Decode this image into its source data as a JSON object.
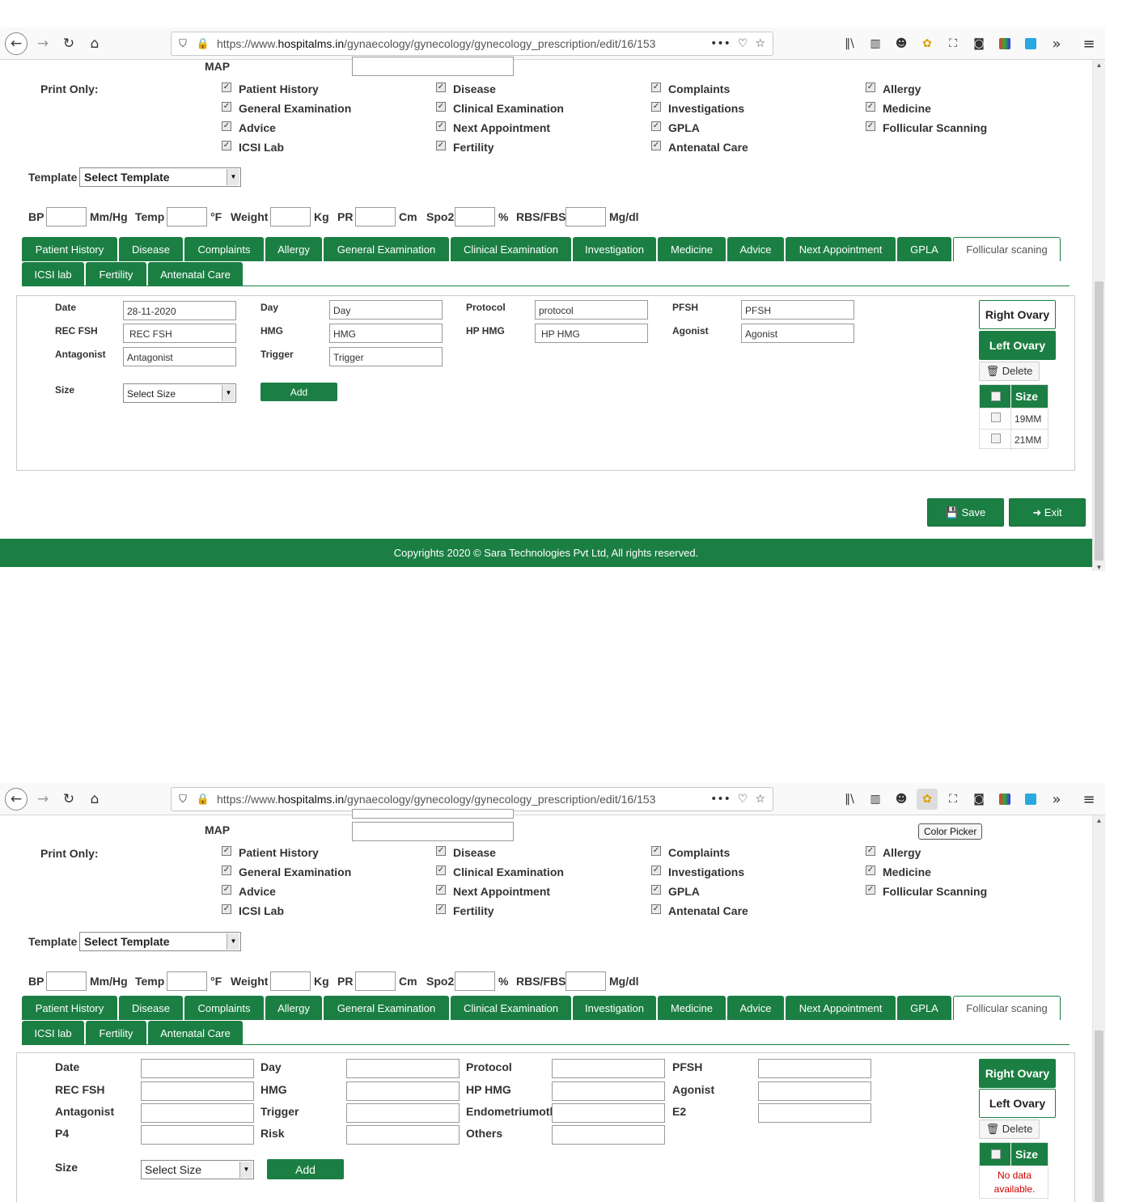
{
  "browser": {
    "url_prefix": "https://www.",
    "url_domain": "hospitalms.in",
    "url_path": "/gynaecology/gynecology/gynecology_prescription/edit/16/153",
    "overflow_icon": "»",
    "menu_icon": "≡"
  },
  "form": {
    "map_label": "MAP",
    "print_only_label": "Print Only:",
    "print_options": [
      [
        "Patient History",
        "General Examination",
        "Advice",
        "ICSI Lab"
      ],
      [
        "Disease",
        "Clinical Examination",
        "Next Appointment",
        "Fertility"
      ],
      [
        "Complaints",
        "Investigations",
        "GPLA",
        "Antenatal Care"
      ],
      [
        "Allergy",
        "Medicine",
        "Follicular Scanning"
      ]
    ],
    "template_label": "Template",
    "template_value": "Select Template",
    "vitals": {
      "bp": "BP",
      "bp_unit": "Mm/Hg",
      "temp": "Temp",
      "temp_unit": "°F",
      "weight": "Weight",
      "weight_unit": "Kg",
      "pr": "PR",
      "pr_unit": "Cm",
      "spo2": "Spo2",
      "spo2_unit": "%",
      "rbs": "RBS/FBS",
      "rbs_unit": "Mg/dl"
    }
  },
  "tabs": {
    "row1": [
      "Patient History",
      "Disease",
      "Complaints",
      "Allergy",
      "General Examination",
      "Clinical Examination",
      "Investigation",
      "Medicine",
      "Advice",
      "Next Appointment",
      "GPLA",
      "Follicular scaning"
    ],
    "row2": [
      "ICSI lab",
      "Fertility",
      "Antenatal Care"
    ]
  },
  "follicular1": {
    "labels": {
      "date": "Date",
      "day": "Day",
      "protocol": "Protocol",
      "pfsh": "PFSH",
      "rec_fsh": "REC FSH",
      "hmg": "HMG",
      "hp_hmg": "HP HMG",
      "agonist": "Agonist",
      "antagonist": "Antagonist",
      "trigger": "Trigger",
      "size": "Size"
    },
    "values": {
      "date": "28-11-2020",
      "day": "Day",
      "protocol": "protocol",
      "pfsh": "PFSH",
      "rec_fsh": "REC FSH",
      "hmg": "HMG",
      "hp_hmg": "HP HMG",
      "agonist": "Agonist",
      "antagonist": "Antagonist",
      "trigger": "Trigger"
    },
    "size_select": "Select Size",
    "add": "Add",
    "right_ovary": "Right Ovary",
    "left_ovary": "Left Ovary",
    "delete": "🗑 Delete",
    "size_header": "Size",
    "sizes": [
      "19MM",
      "21MM"
    ]
  },
  "actions": {
    "save": "💾 Save",
    "exit": "➜ Exit"
  },
  "footer": "Copyrights 2020 © Sara Technologies Pvt Ltd, All rights reserved.",
  "tooltip": "Color Picker",
  "follicular2": {
    "labels": {
      "date": "Date",
      "day": "Day",
      "protocol": "Protocol",
      "pfsh": "PFSH",
      "rec_fsh": "REC FSH",
      "hmg": "HMG",
      "hp_hmg": "HP HMG",
      "agonist": "Agonist",
      "antagonist": "Antagonist",
      "trigger": "Trigger",
      "endometrium": "Endometriumoth",
      "e2": "E2",
      "p4": "P4",
      "risk": "Risk",
      "others": "Others",
      "size": "Size"
    },
    "size_select": "Select Size",
    "add": "Add",
    "right_ovary": "Right Ovary",
    "left_ovary": "Left Ovary",
    "delete": "🗑 Delete",
    "size_header": "Size",
    "no_data": "No data available."
  },
  "colors": {
    "brand_green": "#1b7f43"
  }
}
